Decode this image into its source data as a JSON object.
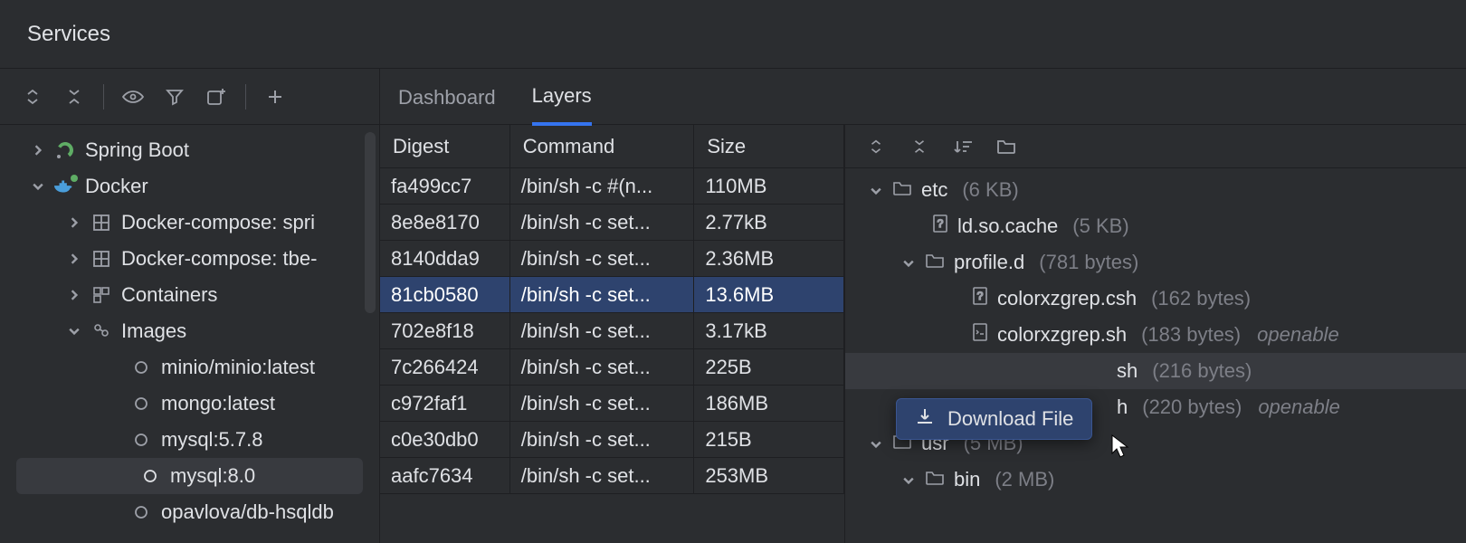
{
  "title": "Services",
  "tabs": {
    "dashboard": "Dashboard",
    "layers": "Layers",
    "active": "layers"
  },
  "tree": {
    "spring_boot": "Spring Boot",
    "docker": "Docker",
    "compose1": "Docker-compose: spri",
    "compose2": "Docker-compose: tbe-",
    "containers": "Containers",
    "images": "Images",
    "image_items": [
      "minio/minio:latest",
      "mongo:latest",
      "mysql:5.7.8",
      "mysql:8.0",
      "opavlova/db-hsqldb"
    ],
    "selected_image_index": 3
  },
  "table": {
    "headers": {
      "digest": "Digest",
      "command": "Command",
      "size": "Size"
    },
    "rows": [
      {
        "digest": "fa499cc7",
        "command": "/bin/sh -c #(n...",
        "size": "110MB"
      },
      {
        "digest": "8e8e8170",
        "command": "/bin/sh -c set...",
        "size": "2.77kB"
      },
      {
        "digest": "8140dda9",
        "command": "/bin/sh -c set...",
        "size": "2.36MB"
      },
      {
        "digest": "81cb0580",
        "command": "/bin/sh -c set...",
        "size": "13.6MB"
      },
      {
        "digest": "702e8f18",
        "command": "/bin/sh -c set...",
        "size": "3.17kB"
      },
      {
        "digest": "7c266424",
        "command": "/bin/sh -c set...",
        "size": "225B"
      },
      {
        "digest": "c972faf1",
        "command": "/bin/sh -c set...",
        "size": "186MB"
      },
      {
        "digest": "c0e30db0",
        "command": "/bin/sh -c set...",
        "size": "215B"
      },
      {
        "digest": "aafc7634",
        "command": "/bin/sh -c set...",
        "size": "253MB"
      }
    ],
    "selected_index": 3
  },
  "files": {
    "etc": {
      "name": "etc",
      "size": "(6 KB)"
    },
    "ld_so_cache": {
      "name": "ld.so.cache",
      "size": "(5 KB)"
    },
    "profile_d": {
      "name": "profile.d",
      "size": "(781 bytes)"
    },
    "colorxzgrep_csh": {
      "name": "colorxzgrep.csh",
      "size": "(162 bytes)"
    },
    "colorxzgrep_sh": {
      "name": "colorxzgrep.sh",
      "size": "(183 bytes)",
      "openable": "openable"
    },
    "hidden_sh": {
      "name": "sh",
      "size": "(216 bytes)"
    },
    "hidden_h": {
      "name": "h",
      "size": "(220 bytes)",
      "openable": "openable"
    },
    "usr": {
      "name": "usr",
      "size": "(5 MB)"
    },
    "bin": {
      "name": "bin",
      "size": "(2 MB)"
    }
  },
  "popup": {
    "label": "Download File"
  }
}
